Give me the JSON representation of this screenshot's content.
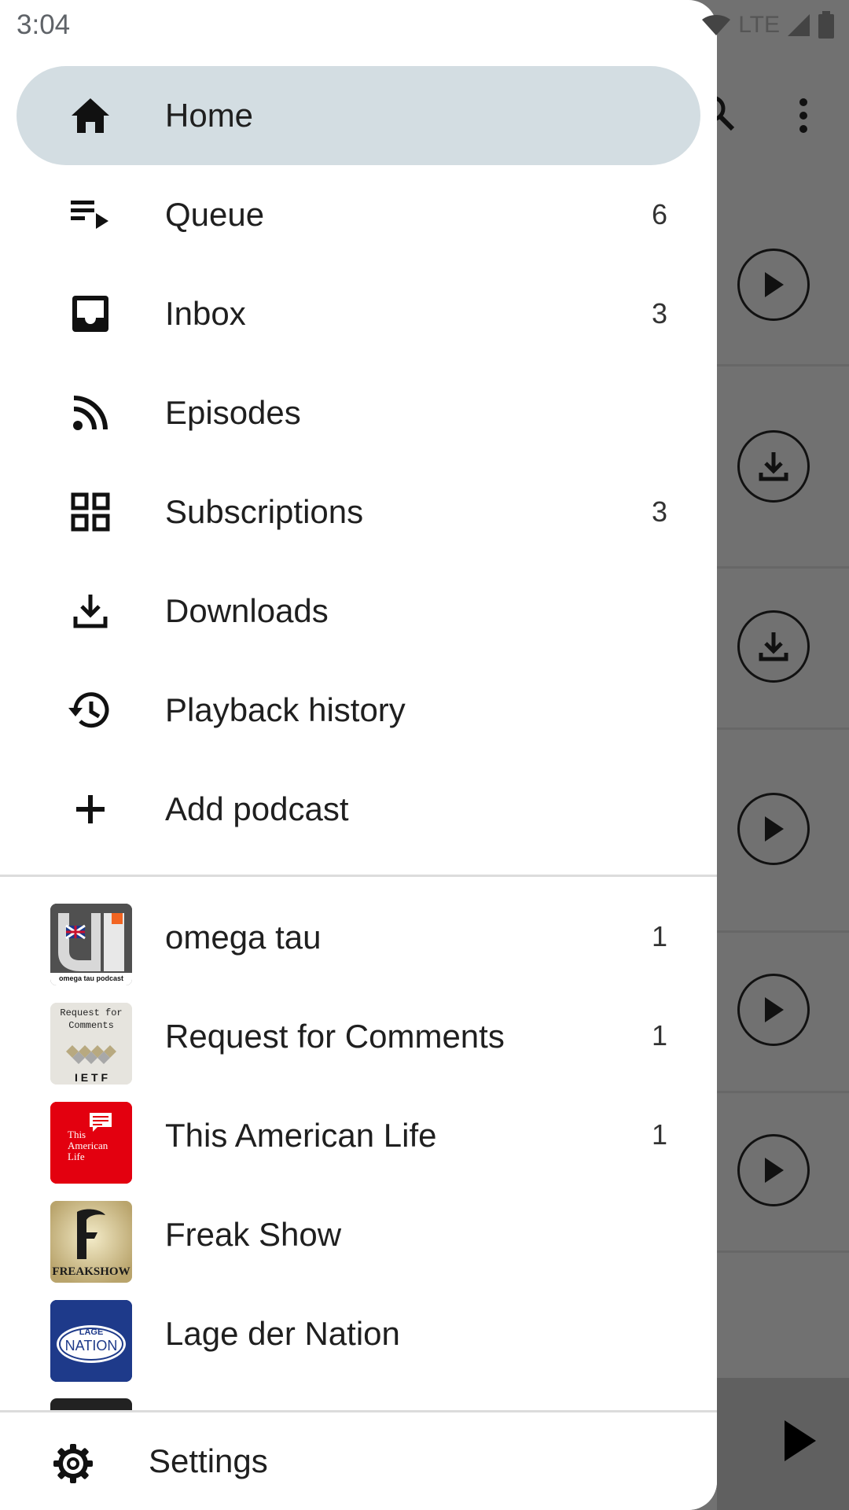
{
  "status_bar": {
    "time": "3:04",
    "network": "LTE"
  },
  "drawer": {
    "nav_items": [
      {
        "label": "Home",
        "count": "",
        "icon": "home-icon",
        "selected": true
      },
      {
        "label": "Queue",
        "count": "6",
        "icon": "queue-icon"
      },
      {
        "label": "Inbox",
        "count": "3",
        "icon": "inbox-icon"
      },
      {
        "label": "Episodes",
        "count": "",
        "icon": "rss-icon"
      },
      {
        "label": "Subscriptions",
        "count": "3",
        "icon": "grid-icon"
      },
      {
        "label": "Downloads",
        "count": "",
        "icon": "download-icon"
      },
      {
        "label": "Playback history",
        "count": "",
        "icon": "history-icon"
      },
      {
        "label": "Add podcast",
        "count": "",
        "icon": "plus-icon"
      }
    ],
    "podcasts": [
      {
        "title": "omega tau",
        "count": "1",
        "thumb_lines": [
          "omega tau podcast"
        ]
      },
      {
        "title": "Request for Comments",
        "count": "1",
        "thumb_lines": [
          "Request for",
          "Comments",
          "I E T F"
        ]
      },
      {
        "title": "This American Life",
        "count": "1",
        "thumb_lines": [
          "This",
          "American",
          "Life"
        ]
      },
      {
        "title": "Freak Show",
        "count": "",
        "thumb_lines": [
          "FREAKSHOW"
        ]
      },
      {
        "title": "Lage der Nation",
        "count": "",
        "thumb_lines": [
          "LAGE",
          "NATION"
        ]
      }
    ],
    "settings_label": "Settings"
  },
  "colors": {
    "selected_bg": "#d3dde2",
    "scrim": "#717171",
    "tal_red": "#e3000f",
    "lage_blue": "#1e3a8a"
  }
}
